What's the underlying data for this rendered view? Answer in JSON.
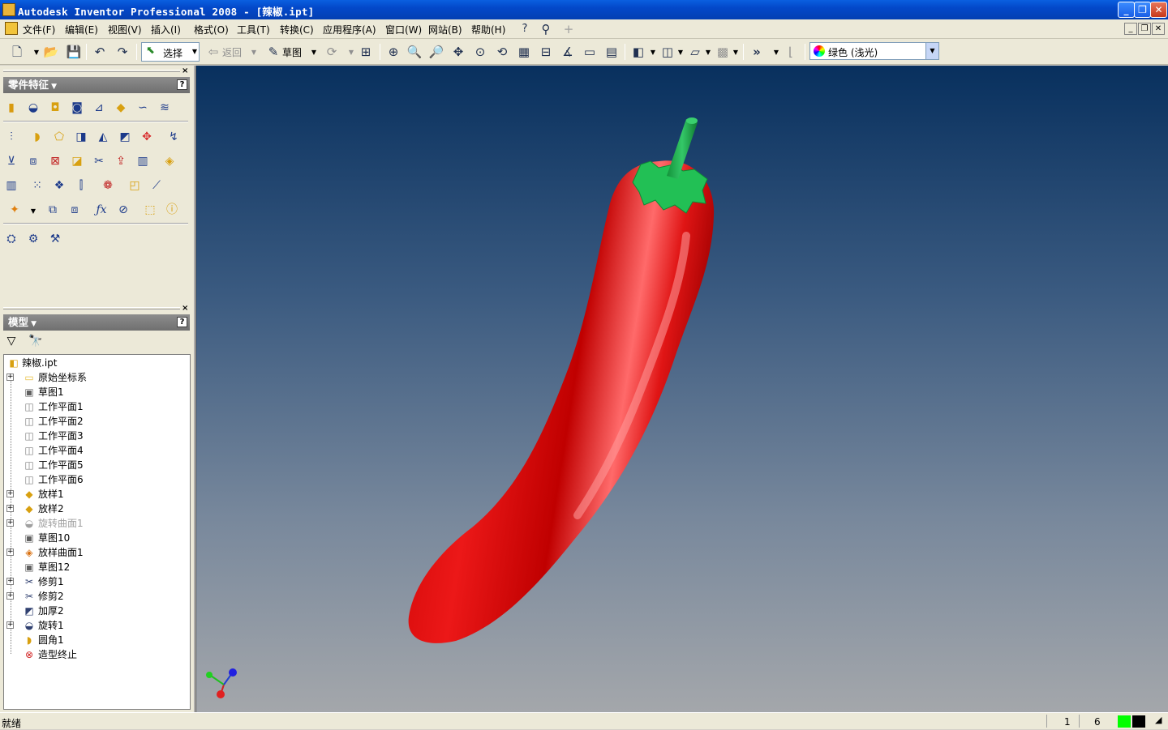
{
  "window": {
    "title": "Autodesk Inventor Professional 2008 - [辣椒.ipt]",
    "btn_minimize": "_",
    "btn_restore": "❐",
    "btn_close": "✕"
  },
  "menu": [
    {
      "label": "文件(F)"
    },
    {
      "label": "编辑(E)"
    },
    {
      "label": "视图(V)"
    },
    {
      "label": "插入(I)"
    },
    {
      "label": "格式(O)"
    },
    {
      "label": "工具(T)"
    },
    {
      "label": "转换(C)"
    },
    {
      "label": "应用程序(A)"
    },
    {
      "label": "窗口(W)"
    },
    {
      "label": "网站(B)"
    },
    {
      "label": "帮助(H)"
    }
  ],
  "toolbar": {
    "select_label": "选择",
    "back_label": "返回",
    "sketch_label": "草图",
    "color_value": "绿色 (浅光)"
  },
  "features_panel": {
    "title": "零件特征",
    "help": "?"
  },
  "model_panel": {
    "title": "模型",
    "help": "?"
  },
  "tree": [
    {
      "label": "辣椒.ipt",
      "icon": "part-icon",
      "expander": ""
    },
    {
      "label": "原始坐标系",
      "icon": "folder-icon",
      "expander": "+"
    },
    {
      "label": "草图1",
      "icon": "sketch-icon",
      "expander": ""
    },
    {
      "label": "工作平面1",
      "icon": "work-plane-icon",
      "expander": ""
    },
    {
      "label": "工作平面2",
      "icon": "work-plane-icon",
      "expander": ""
    },
    {
      "label": "工作平面3",
      "icon": "work-plane-icon",
      "expander": ""
    },
    {
      "label": "工作平面4",
      "icon": "work-plane-icon",
      "expander": ""
    },
    {
      "label": "工作平面5",
      "icon": "work-plane-icon",
      "expander": ""
    },
    {
      "label": "工作平面6",
      "icon": "work-plane-icon",
      "expander": ""
    },
    {
      "label": "放样1",
      "icon": "loft-icon",
      "expander": "+"
    },
    {
      "label": "放样2",
      "icon": "loft-icon",
      "expander": "+"
    },
    {
      "label": "旋转曲面1",
      "icon": "revolve-surface-icon",
      "expander": "+",
      "dim": true
    },
    {
      "label": "草图10",
      "icon": "sketch-icon",
      "expander": ""
    },
    {
      "label": "放样曲面1",
      "icon": "loft-surface-icon",
      "expander": "+"
    },
    {
      "label": "草图12",
      "icon": "sketch-icon",
      "expander": ""
    },
    {
      "label": "修剪1",
      "icon": "trim-icon",
      "expander": "+"
    },
    {
      "label": "修剪2",
      "icon": "trim-icon",
      "expander": "+"
    },
    {
      "label": "加厚2",
      "icon": "thicken-icon",
      "expander": ""
    },
    {
      "label": "旋转1",
      "icon": "revolve-icon",
      "expander": "+"
    },
    {
      "label": "圆角1",
      "icon": "fillet-icon",
      "expander": ""
    },
    {
      "label": "造型终止",
      "icon": "end-of-part-icon",
      "expander": ""
    }
  ],
  "status": {
    "text": "就绪",
    "num1": "1",
    "num2": "6"
  },
  "colors": {
    "pepper_red": "#e01010",
    "calyx_green": "#1fb14a",
    "status_green": "#00ff00"
  }
}
